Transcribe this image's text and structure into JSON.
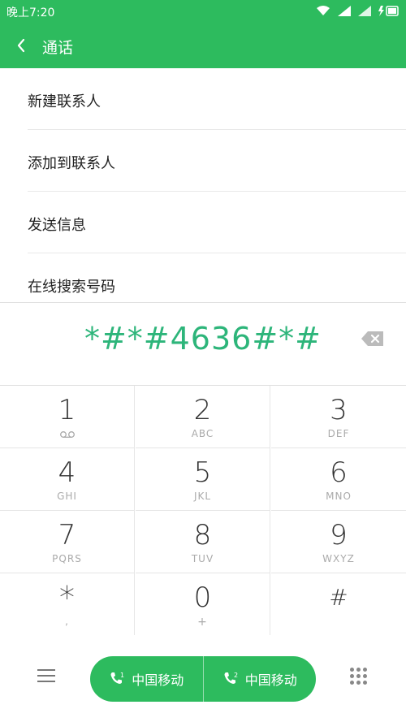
{
  "status_bar": {
    "time": "晚上7:20"
  },
  "header": {
    "title": "通话"
  },
  "menu": {
    "items": [
      {
        "label": "新建联系人"
      },
      {
        "label": "添加到联系人"
      },
      {
        "label": "发送信息"
      },
      {
        "label": "在线搜索号码"
      }
    ]
  },
  "dialer": {
    "number": "*#*#4636#*#",
    "keys": [
      {
        "digit": "1",
        "letters": "voicemail"
      },
      {
        "digit": "2",
        "letters": "ABC"
      },
      {
        "digit": "3",
        "letters": "DEF"
      },
      {
        "digit": "4",
        "letters": "GHI"
      },
      {
        "digit": "5",
        "letters": "JKL"
      },
      {
        "digit": "6",
        "letters": "MNO"
      },
      {
        "digit": "7",
        "letters": "PQRS"
      },
      {
        "digit": "8",
        "letters": "TUV"
      },
      {
        "digit": "9",
        "letters": "WXYZ"
      },
      {
        "digit": "*",
        "letters": ","
      },
      {
        "digit": "0",
        "letters": "+"
      },
      {
        "digit": "#",
        "letters": ""
      }
    ]
  },
  "call_buttons": [
    {
      "sim": "1",
      "label": "中国移动"
    },
    {
      "sim": "2",
      "label": "中国移动"
    }
  ],
  "colors": {
    "accent": "#2dbb5e",
    "number": "#2db57a"
  }
}
